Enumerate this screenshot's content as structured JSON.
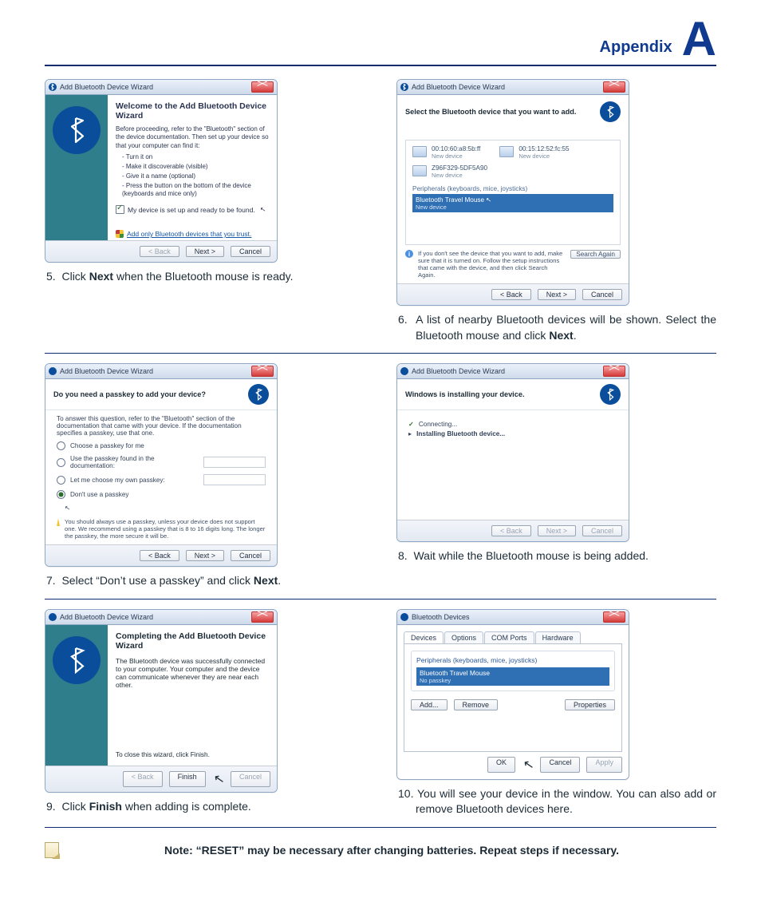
{
  "header": {
    "appendix": "Appendix",
    "letter": "A"
  },
  "steps": {
    "s5": {
      "num": "5.",
      "html_pre": "Click ",
      "bold": "Next",
      "html_post": " when the Bluetooth mouse is ready."
    },
    "s6": {
      "num": "6.",
      "text": "A list of nearby Bluetooth devices will be shown. Select the Bluetooth mouse and click ",
      "bold": "Next",
      "tail": "."
    },
    "s7": {
      "num": "7.",
      "text": "Select “Don’t use a passkey” and click ",
      "bold": "Next",
      "tail": "."
    },
    "s8": {
      "num": "8.",
      "text": "Wait while the Bluetooth mouse is being added."
    },
    "s9": {
      "num": "9.",
      "text_pre": "Click ",
      "bold": "Finish",
      "text_post": " when adding is complete."
    },
    "s10": {
      "num": "10.",
      "text": "You will see your device in the window. You can also add or remove Bluetooth devices here."
    }
  },
  "wizards": {
    "common": {
      "title": "Add Bluetooth Device Wizard",
      "btn_back": "< Back",
      "btn_next": "Next >",
      "btn_cancel": "Cancel",
      "btn_finish": "Finish"
    },
    "w5": {
      "heading": "Welcome to the Add Bluetooth Device Wizard",
      "intro": "Before proceeding, refer to the \"Bluetooth\" section of the device documentation. Then set up your device so that your computer can find it:",
      "bullets": [
        "Turn it on",
        "Make it discoverable (visible)",
        "Give it a name (optional)",
        "Press the button on the bottom of the device (keyboards and mice only)"
      ],
      "checkbox": "My device is set up and ready to be found.",
      "link": "Add only Bluetooth devices that you trust."
    },
    "w6": {
      "prompt": "Select the Bluetooth device that you want to add.",
      "devices_row": [
        {
          "line1": "00:10:60:a8:5b:ff",
          "line2": "New device"
        },
        {
          "line1": "00:15:12:52:fc:55",
          "line2": "New device"
        }
      ],
      "device3": {
        "line1": "Z96F329-5DF5A90",
        "line2": "New device"
      },
      "category": "Peripherals (keyboards, mice, joysticks)",
      "selected": {
        "line1": "Bluetooth Travel Mouse",
        "line2": "New device"
      },
      "hint": "If you don't see the device that you want to add, make sure that it is turned on. Follow the setup instructions that came with the device, and then click Search Again.",
      "search_again": "Search Again"
    },
    "w7": {
      "question": "Do you need a passkey to add your device?",
      "hint": "To answer this question, refer to the \"Bluetooth\" section of the documentation that came with your device. If the documentation specifies a passkey, use that one.",
      "opt1": "Choose a passkey for me",
      "opt2": "Use the passkey found in the documentation:",
      "opt3": "Let me choose my own passkey:",
      "opt4": "Don't use a passkey",
      "warn": "You should always use a passkey, unless your device does not support one. We recommend using a passkey that is 8 to 16 digits long. The longer the passkey, the more secure it will be."
    },
    "w8": {
      "heading": "Windows is installing your device.",
      "item_ok": "Connecting...",
      "item_run": "Installing Bluetooth device..."
    },
    "w9": {
      "heading": "Completing the Add Bluetooth Device Wizard",
      "intro": "The Bluetooth device was successfully connected to your computer. Your computer and the device can communicate whenever they are near each other.",
      "close_line": "To close this wizard, click Finish."
    },
    "w10": {
      "title": "Bluetooth Devices",
      "tabs": [
        "Devices",
        "Options",
        "COM Ports",
        "Hardware"
      ],
      "group_label": "Peripherals (keyboards, mice, joysticks)",
      "selected": {
        "line1": "Bluetooth Travel Mouse",
        "line2": "No passkey"
      },
      "btn_add": "Add...",
      "btn_remove": "Remove",
      "btn_props": "Properties",
      "btn_ok": "OK",
      "btn_cancel": "Cancel",
      "btn_apply": "Apply"
    }
  },
  "note": "Note: “RESET” may be necessary after changing batteries. Repeat steps if necessary."
}
